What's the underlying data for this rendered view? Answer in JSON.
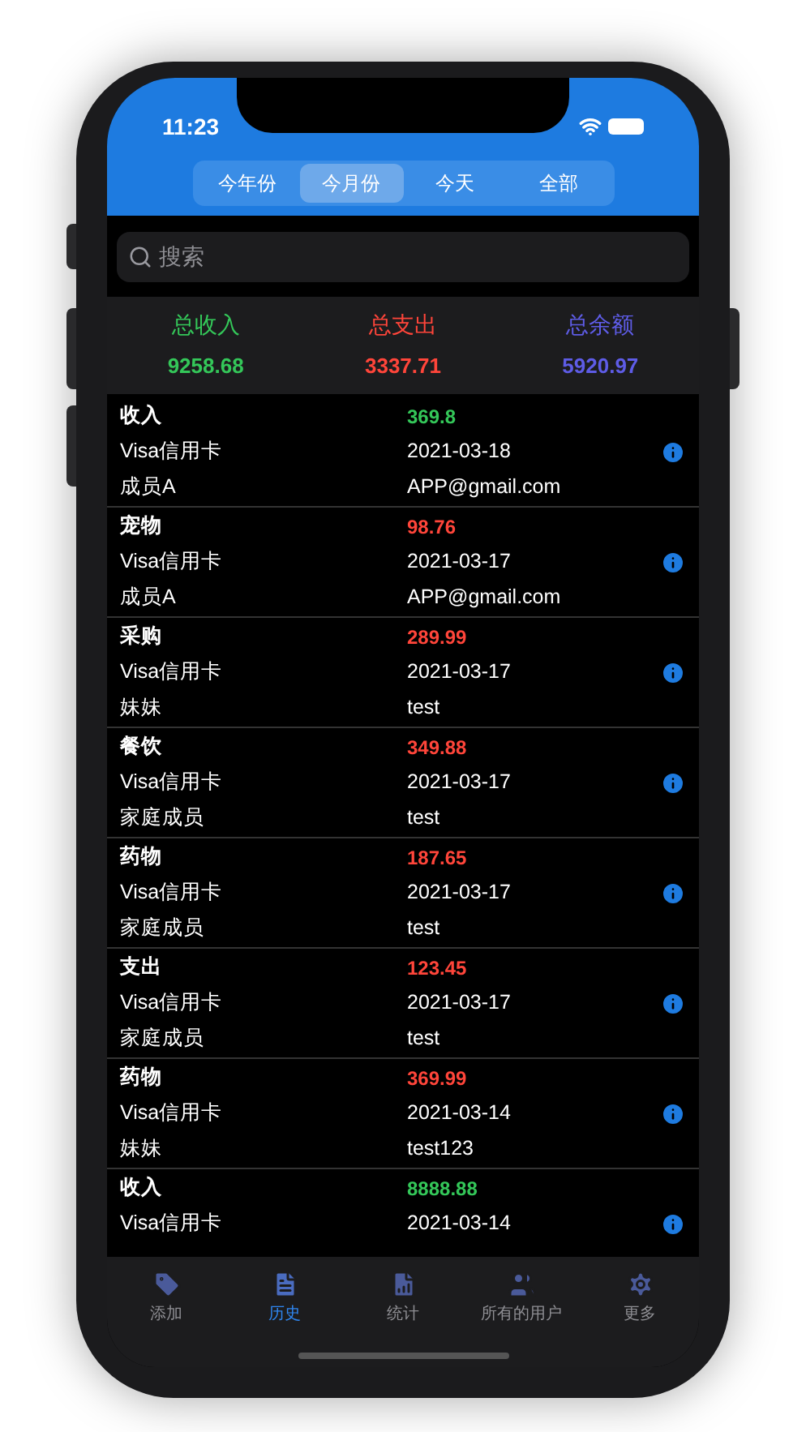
{
  "status_bar": {
    "time": "11:23"
  },
  "period_tabs": [
    {
      "label": "今年份",
      "selected": false
    },
    {
      "label": "今月份",
      "selected": true
    },
    {
      "label": "今天",
      "selected": false
    },
    {
      "label": "全部",
      "selected": false
    }
  ],
  "search": {
    "placeholder": "搜索"
  },
  "summary": [
    {
      "label": "总收入",
      "value": "9258.68",
      "color": "#34c759"
    },
    {
      "label": "总支出",
      "value": "3337.71",
      "color": "#ff453a"
    },
    {
      "label": "总余额",
      "value": "5920.97",
      "color": "#5e5ce6"
    }
  ],
  "records": [
    {
      "category": "收入",
      "kind": "income",
      "amount": "369.8",
      "account": "Visa信用卡",
      "date": "2021-03-18",
      "member": "成员A",
      "note": "APP@gmail.com"
    },
    {
      "category": "宠物",
      "kind": "expense",
      "amount": "98.76",
      "account": "Visa信用卡",
      "date": "2021-03-17",
      "member": "成员A",
      "note": "APP@gmail.com"
    },
    {
      "category": "采购",
      "kind": "expense",
      "amount": "289.99",
      "account": "Visa信用卡",
      "date": "2021-03-17",
      "member": "妹妹",
      "note": "test"
    },
    {
      "category": "餐饮",
      "kind": "expense",
      "amount": "349.88",
      "account": "Visa信用卡",
      "date": "2021-03-17",
      "member": "家庭成员",
      "note": "test"
    },
    {
      "category": "药物",
      "kind": "expense",
      "amount": "187.65",
      "account": "Visa信用卡",
      "date": "2021-03-17",
      "member": "家庭成员",
      "note": "test"
    },
    {
      "category": "支出",
      "kind": "expense",
      "amount": "123.45",
      "account": "Visa信用卡",
      "date": "2021-03-17",
      "member": "家庭成员",
      "note": "test"
    },
    {
      "category": "药物",
      "kind": "expense",
      "amount": "369.99",
      "account": "Visa信用卡",
      "date": "2021-03-14",
      "member": "妹妹",
      "note": "test123"
    },
    {
      "category": "收入",
      "kind": "income",
      "amount": "8888.88",
      "account": "Visa信用卡",
      "date": "2021-03-14"
    }
  ],
  "tab_bar": [
    {
      "label": "添加",
      "kind": "add",
      "selected": false
    },
    {
      "label": "历史",
      "kind": "history",
      "selected": true
    },
    {
      "label": "统计",
      "kind": "stats",
      "selected": false
    },
    {
      "label": "所有的用户",
      "kind": "users",
      "selected": false
    },
    {
      "label": "更多",
      "kind": "more",
      "selected": false
    }
  ]
}
